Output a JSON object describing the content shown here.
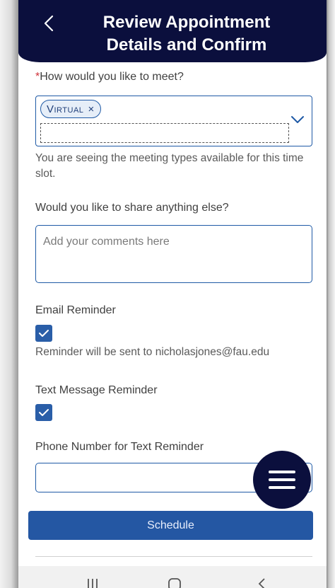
{
  "header": {
    "title_line1": "Review Appointment",
    "title_line2": "Details and Confirm"
  },
  "meeting": {
    "required_mark": "*",
    "label": "How would you like to meet?",
    "selected_chip": "Virtual",
    "chip_remove": "×",
    "hint": "You are seeing the meeting types available for this time slot."
  },
  "comments": {
    "label": "Would you like to share anything else?",
    "placeholder": "Add your comments here"
  },
  "email_reminder": {
    "label": "Email Reminder",
    "checked": true,
    "note": "Reminder will be sent to nicholasjones@fau.edu"
  },
  "text_reminder": {
    "label": "Text Message Reminder",
    "checked": true
  },
  "phone": {
    "label": "Phone Number for Text Reminder",
    "value": ""
  },
  "actions": {
    "schedule_label": "Schedule"
  },
  "colors": {
    "header_bg": "#0b0f3d",
    "accent": "#2457a3",
    "required": "#d0343c"
  }
}
